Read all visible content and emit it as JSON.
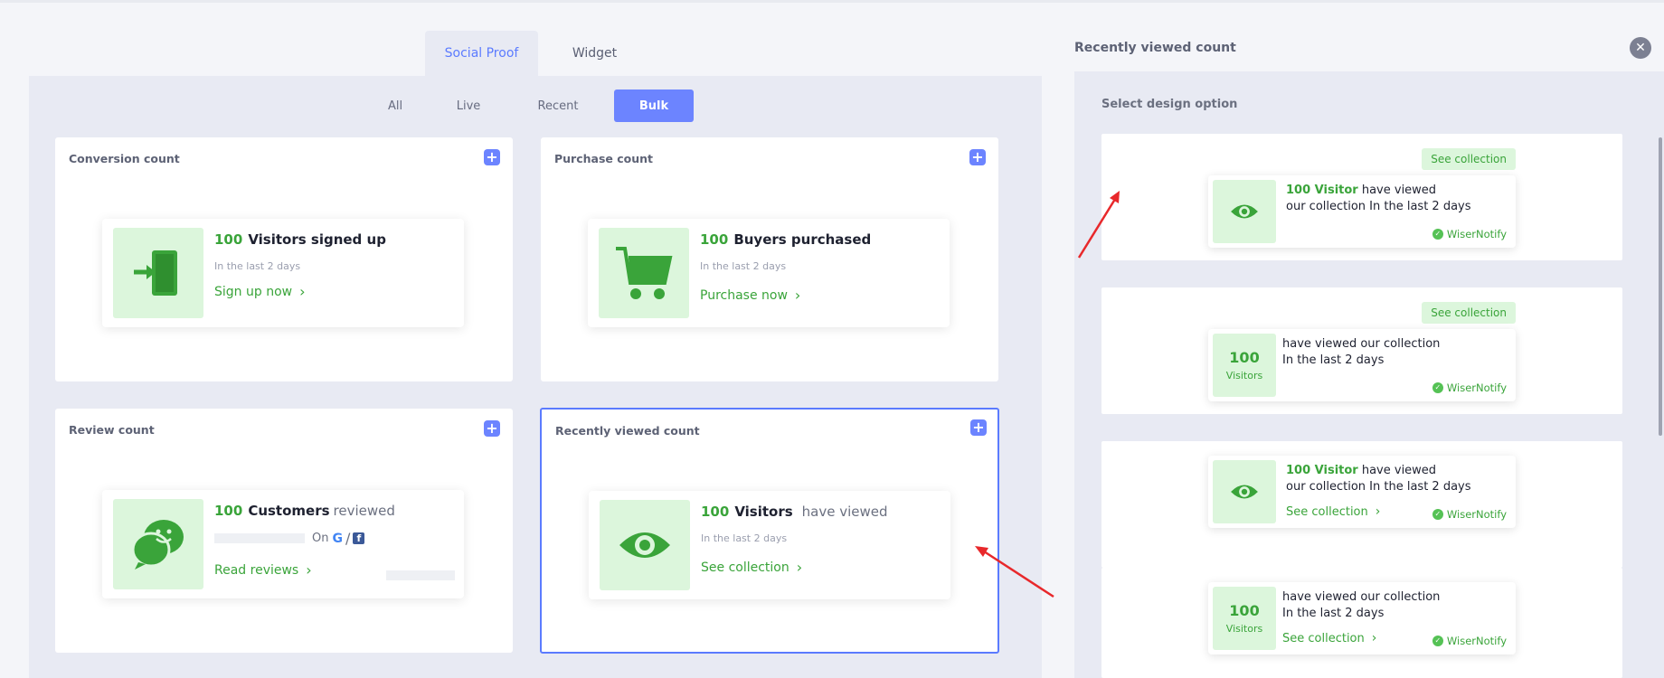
{
  "tabs": [
    {
      "label": "Social Proof",
      "active": true
    },
    {
      "label": "Widget",
      "active": false
    }
  ],
  "filters": [
    "All",
    "Live",
    "Recent",
    "Bulk"
  ],
  "cards": {
    "conversion": {
      "title": "Conversion count",
      "number": "100",
      "headline": "Visitors signed up",
      "sub": "In the last 2 days",
      "cta": "Sign up now"
    },
    "purchase": {
      "title": "Purchase count",
      "number": "100",
      "headline": "Buyers purchased",
      "sub": "In the last 2 days",
      "cta": "Purchase now"
    },
    "review": {
      "title": "Review count",
      "number": "100",
      "headline_bold": "Customers",
      "headline_light": "reviewed",
      "on": "On",
      "cta": "Read reviews"
    },
    "viewed": {
      "title": "Recently viewed count",
      "number": "100",
      "headline_bold": "Visitors",
      "headline_light": "have viewed",
      "sub": "In the last 2 days",
      "cta": "See collection"
    }
  },
  "side": {
    "title": "Recently viewed count",
    "select_label": "Select design option",
    "badge": "See collection",
    "brand": "WiserNotify",
    "options": [
      {
        "num_text": "100 Visitor",
        "line1_rest": "have viewed",
        "line2": "our collection In the last 2 days"
      },
      {
        "num": "100",
        "label": "Visitors",
        "line1": "have viewed our collection",
        "line2": "In the last 2 days"
      },
      {
        "num_text": "100 Visitor",
        "line1_rest": "have viewed",
        "line2": "our collection In the last 2 days",
        "cta": "See collection"
      },
      {
        "num": "100",
        "label": "Visitors",
        "line1": "have viewed our collection",
        "line2": "In the last 2 days",
        "cta": "See collection"
      }
    ]
  },
  "colors": {
    "accent": "#6c84ff",
    "green": "#3aa43a",
    "green_bg": "#dcf6dc",
    "arrow": "#e8282b"
  }
}
